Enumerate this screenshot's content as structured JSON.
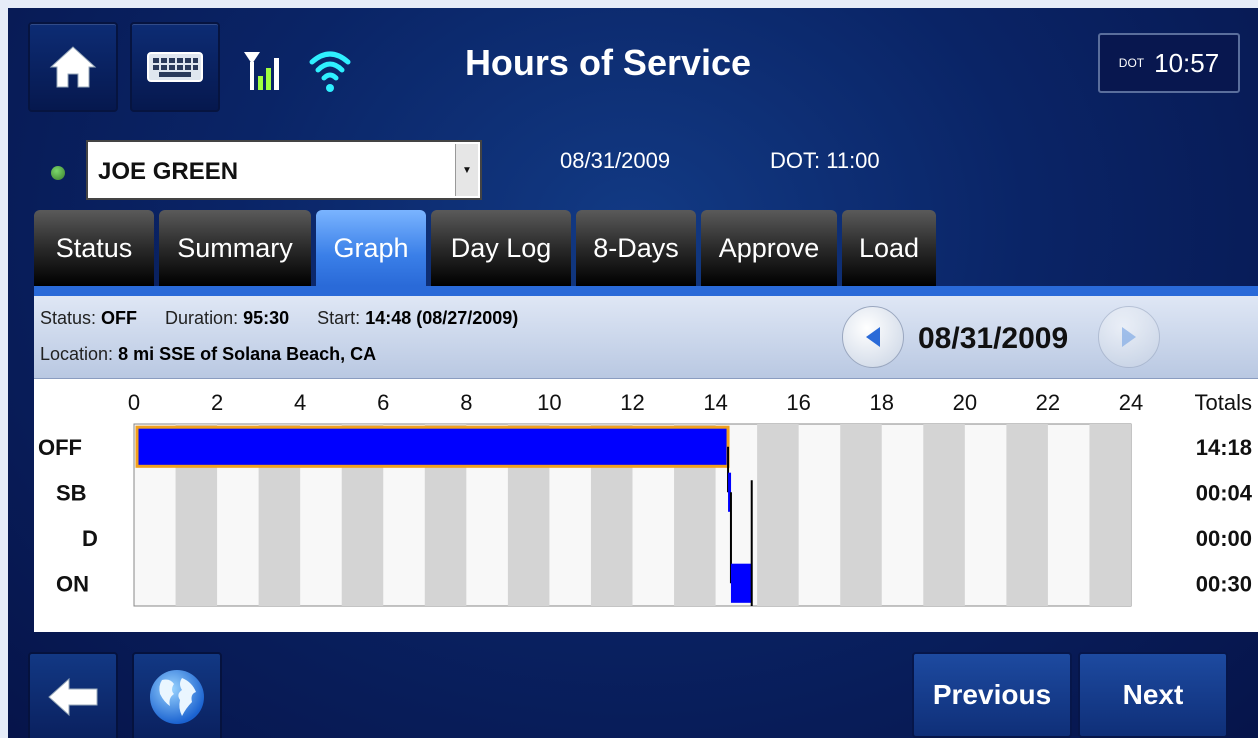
{
  "app": {
    "title": "Hours of Service",
    "clock": {
      "label": "DOT",
      "time": "10:57"
    }
  },
  "header": {
    "driver": "JOE GREEN",
    "date": "08/31/2009",
    "dot": "DOT: 11:00"
  },
  "tabs": [
    {
      "label": "Status",
      "active": false
    },
    {
      "label": "Summary",
      "active": false
    },
    {
      "label": "Graph",
      "active": true
    },
    {
      "label": "Day Log",
      "active": false
    },
    {
      "label": "8-Days",
      "active": false
    },
    {
      "label": "Approve",
      "active": false
    },
    {
      "label": "Load",
      "active": false
    }
  ],
  "status_info": {
    "status_label": "Status:",
    "status_value": "OFF",
    "duration_label": "Duration:",
    "duration_value": "95:30",
    "start_label": "Start:",
    "start_value": "14:48 (08/27/2009)",
    "location_label": "Location:",
    "location_value": "8 mi SSE of Solana Beach, CA"
  },
  "nav": {
    "date": "08/31/2009",
    "prev_icon": "triangle-left-icon",
    "next_icon": "triangle-right-icon"
  },
  "footer": {
    "previous_label": "Previous",
    "next_label": "Next",
    "back_icon": "arrow-left-icon",
    "globe_icon": "globe-icon"
  },
  "colors": {
    "duty_bar": "#0000ff",
    "selected_outline": "#f0a020",
    "active_tab": "#3a7fe8"
  },
  "chart_data": {
    "type": "duty-status-graph",
    "x_ticks": [
      "0",
      "2",
      "4",
      "6",
      "8",
      "10",
      "12",
      "14",
      "16",
      "18",
      "20",
      "22",
      "24"
    ],
    "xlim": [
      0,
      24
    ],
    "rows": [
      "OFF",
      "SB",
      "D",
      "ON"
    ],
    "totals_label": "Totals",
    "totals": [
      "14:18",
      "00:04",
      "00:00",
      "00:30"
    ],
    "segments": [
      {
        "status": "OFF",
        "start": 0,
        "end": 14.3,
        "selected": true
      },
      {
        "status": "SB",
        "start": 14.3,
        "end": 14.37
      },
      {
        "status": "ON",
        "start": 14.37,
        "end": 14.87
      }
    ]
  }
}
